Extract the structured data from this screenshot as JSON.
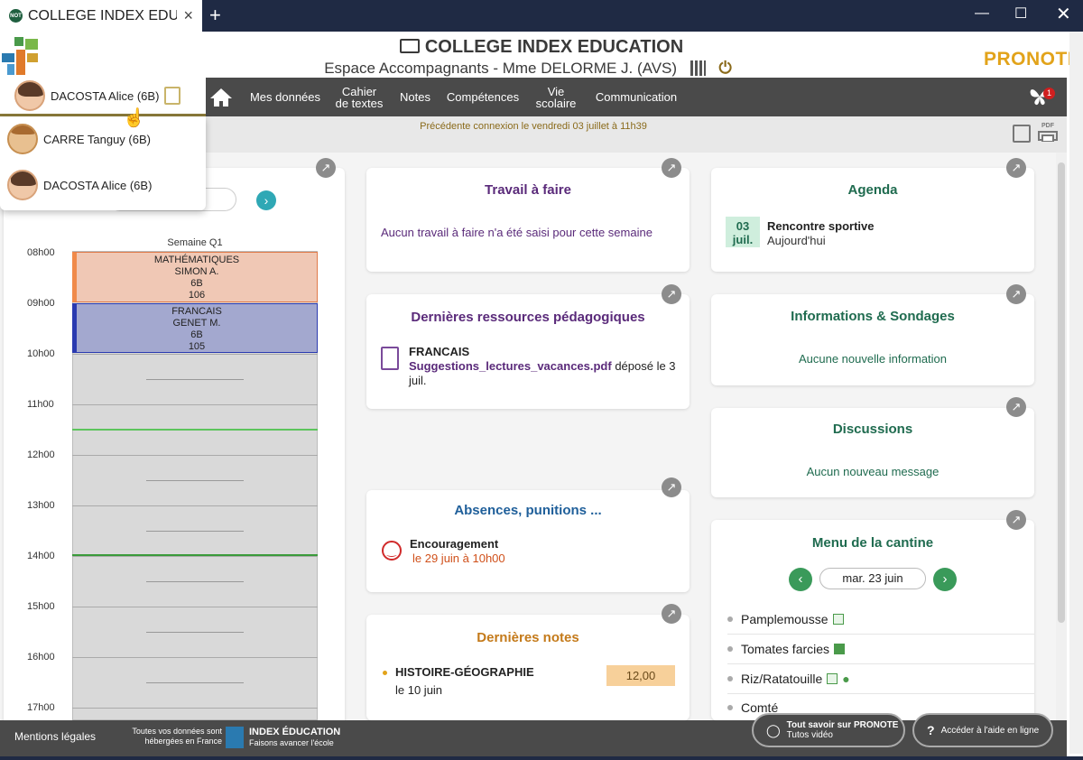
{
  "browser": {
    "tab_title": "COLLEGE INDEX EDUCATION",
    "new_tab": "+",
    "close_tab": "×"
  },
  "header": {
    "school": "COLLEGE INDEX EDUCATION",
    "subtitle": "Espace Accompagnants - Mme DELORME J. (AVS)",
    "logo": "PRONOTE"
  },
  "nav": {
    "student": "DACOSTA Alice (6B)",
    "items": [
      "Mes données",
      "Cahier\nde textes",
      "Notes",
      "Compétences",
      "Vie\nscolaire",
      "Communication"
    ],
    "notifications": "1"
  },
  "dropdown": {
    "students": [
      "CARRE Tanguy (6B)",
      "DACOSTA Alice (6B)"
    ]
  },
  "infobar": {
    "last_connection": "Précédente connexion le vendredi 03 juillet à 11h39",
    "pdf_label": "PDF"
  },
  "edt": {
    "week": "Semaine Q1",
    "hours": [
      "08h00",
      "09h00",
      "10h00",
      "11h00",
      "12h00",
      "13h00",
      "14h00",
      "15h00",
      "16h00",
      "17h00"
    ],
    "courses": [
      {
        "subject": "MATHÉMATIQUES",
        "teacher": "SIMON A.",
        "class": "6B",
        "room": "106"
      },
      {
        "subject": "FRANCAIS",
        "teacher": "GENET M.",
        "class": "6B",
        "room": "105"
      }
    ]
  },
  "travail": {
    "title": "Travail à faire",
    "text": "Aucun travail à faire n'a été saisi pour cette semaine"
  },
  "ressources": {
    "title": "Dernières ressources pédagogiques",
    "subject": "FRANCAIS",
    "file": "Suggestions_lectures_vacances.pdf",
    "suffix": " déposé le 3 juil."
  },
  "absences": {
    "title": "Absences, punitions ...",
    "label": "Encouragement",
    "date": "le 29 juin à 10h00"
  },
  "notes": {
    "title": "Dernières notes",
    "subject": "HISTOIRE-GÉOGRAPHIE",
    "date": "le 10 juin",
    "grade": "12,00"
  },
  "agenda": {
    "title": "Agenda",
    "day": "03",
    "month": "juil.",
    "event": "Rencontre sportive",
    "when": "Aujourd'hui"
  },
  "infos": {
    "title": "Informations & Sondages",
    "text": "Aucune nouvelle information"
  },
  "discussions": {
    "title": "Discussions",
    "text": "Aucun nouveau message"
  },
  "cantine": {
    "title": "Menu de la cantine",
    "date": "mar. 23 juin",
    "items": [
      "Pamplemousse",
      "Tomates farcies",
      "Riz/Ratatouille",
      "Comté"
    ]
  },
  "footer": {
    "legal": "Mentions légales",
    "hosted": "Toutes vos données sont\nhébergées en France",
    "brand": "INDEX ÉDUCATION",
    "slogan": "Faisons avancer l'école",
    "tutos_title": "Tout savoir sur PRONOTE",
    "tutos_sub": "Tutos vidéo",
    "help": "Accéder à l'aide en ligne"
  },
  "colors": {
    "nav_bg": "#4a4a4a",
    "accent_purple": "#5a2a7a",
    "accent_teal": "#1f6b4f",
    "accent_blue": "#1f5f9a",
    "accent_orange": "#c47a1a",
    "logo": "#e2a31a"
  }
}
